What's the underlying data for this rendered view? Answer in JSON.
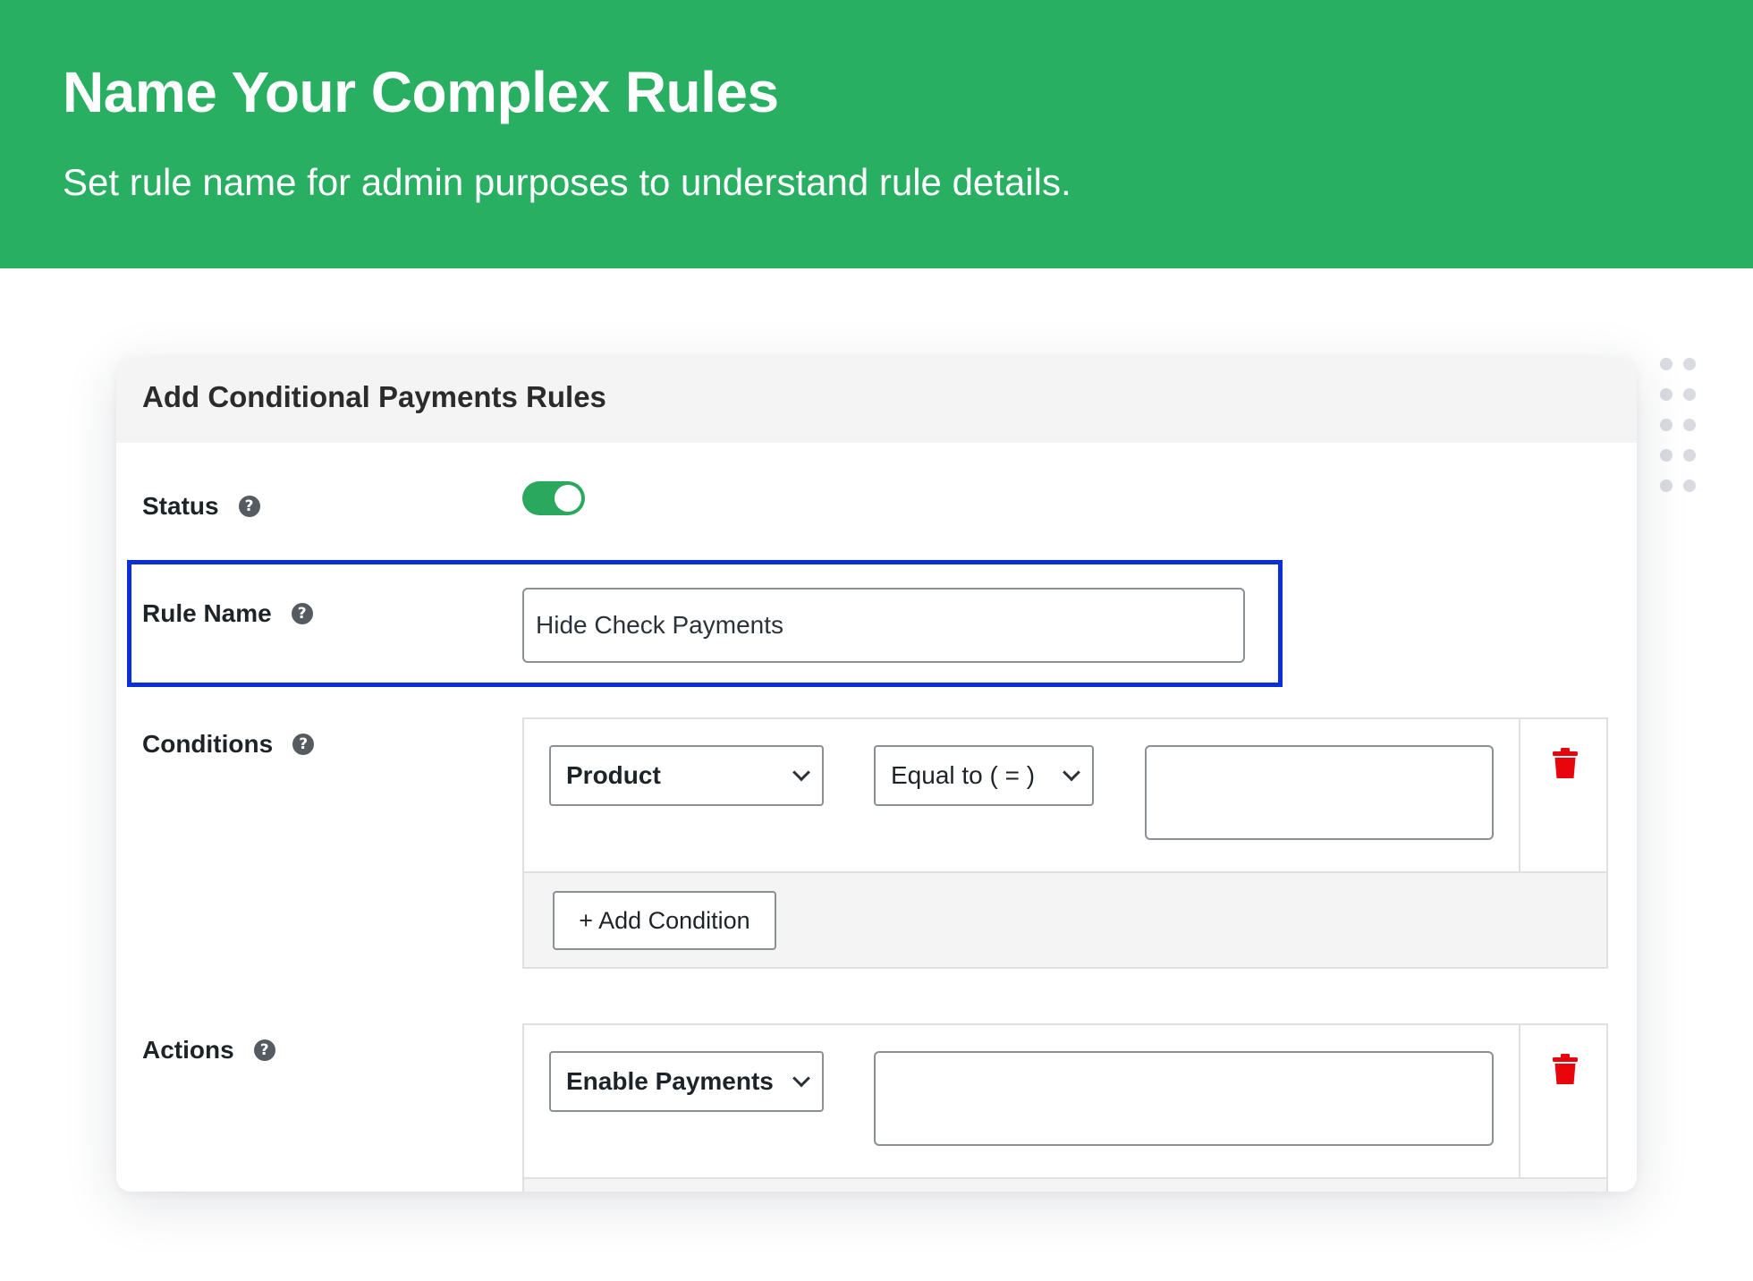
{
  "banner": {
    "title": "Name Your Complex Rules",
    "subtitle": "Set rule name for admin purposes to understand rule details."
  },
  "card": {
    "title": "Add Conditional Payments Rules",
    "status": {
      "label": "Status",
      "help_icon": "question-mark-icon",
      "enabled": true,
      "toggle_color": "#2aa85d"
    },
    "rule_name": {
      "label": "Rule Name",
      "value": "Hide Check Payments",
      "highlight_color": "#0a2ed8"
    },
    "conditions": {
      "label": "Conditions",
      "field_select": "Product",
      "operator_select": "Equal to ( = )",
      "value": "",
      "add_button": "+ Add Condition",
      "delete_icon": "trash-icon"
    },
    "actions": {
      "label": "Actions",
      "action_select": "Enable Payments",
      "value": "",
      "delete_icon": "trash-icon"
    }
  },
  "colors": {
    "banner": "#29af62",
    "trash": "#e8060c",
    "help_icon": "#555b60"
  }
}
